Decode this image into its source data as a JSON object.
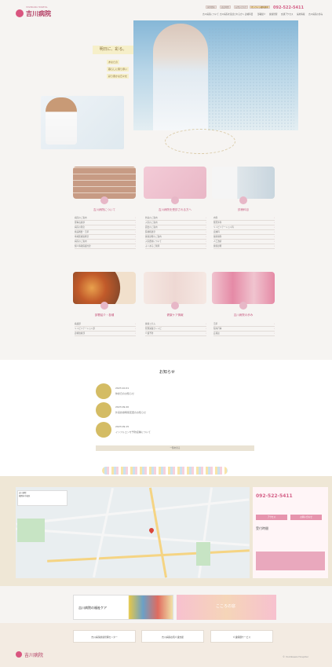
{
  "header": {
    "logo_name": "吉川病院",
    "logo_sub": "YOSHIKAWA HOSPITAL",
    "util_links": [
      "採用情報",
      "面会時間",
      "お問い合わせ",
      "オンライン資料請求"
    ],
    "phone": "092-522-5411",
    "nav": [
      "吉川病院について",
      "吉川病院を受診される方へ",
      "診療科目",
      "部署紹介",
      "健康管理",
      "交通アクセス",
      "採用情報",
      "吉川病院の歩み"
    ]
  },
  "hero": {
    "catch": "明日に、彩る。",
    "sub_lines": [
      "あなたの",
      "暮らしに寄り添い",
      "彩り豊かな日々を"
    ]
  },
  "sections": [
    {
      "title": "吉川病院について",
      "links": [
        "病院のご案内",
        "理事長挨拶",
        "病院の理念",
        "施設概要・沿革",
        "地域医療連携室",
        "病院のご案内",
        "個人情報保護方針"
      ]
    },
    {
      "title": "吉川病院を受診される方へ",
      "links": [
        "外来のご案内",
        "入院のご案内",
        "面会のご案内",
        "医療相談室",
        "健康診断のご案内",
        "入院費用について",
        "よくあるご質問"
      ]
    },
    {
      "title": "診療科目",
      "links": [
        "内科",
        "整形外科",
        "リハビリテーション科",
        "皮膚科",
        "放射線科",
        "人工透析",
        "健康診断"
      ]
    },
    {
      "title": "部署紹介・各種",
      "links": [
        "看護部",
        "リハビリテーション部",
        "診療技術部"
      ]
    },
    {
      "title": "健康ケア情報",
      "links": [
        "健康コラム",
        "管理栄養士レシピ",
        "介護予防"
      ]
    },
    {
      "title": "吉川病院の歩み",
      "links": [
        "沿革",
        "院内行事",
        "広報誌"
      ]
    }
  ],
  "news": {
    "title": "お知らせ",
    "items": [
      {
        "date": "2023.10.01",
        "text": "休診日のお知らせ"
      },
      {
        "date": "2023.09.20",
        "text": "外来診療時間変更のお知らせ"
      },
      {
        "date": "2023.09.15",
        "text": "インフルエンザ予防接種について"
      }
    ],
    "more": "一覧を見る"
  },
  "access": {
    "map_label": "吉川病院",
    "map_address": "福岡市中央区",
    "phone": "092-522-5411",
    "hours_label": "受付時間",
    "buttons": [
      "アクセス",
      "お問い合わせ"
    ]
  },
  "banners": [
    "吉川病院の福祉ケア",
    "こころの窓"
  ],
  "footer": {
    "buttons": [
      "吉川病院健康管理センター",
      "吉川病院在宅介護支援",
      "介護保険サービス"
    ],
    "copyright": "© Yoshikawa Hospital"
  }
}
